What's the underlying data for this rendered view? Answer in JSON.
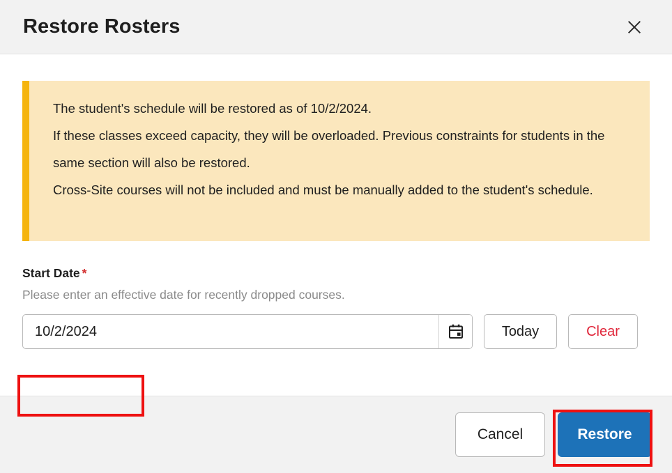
{
  "dialog": {
    "title": "Restore Rosters",
    "close_icon": "close-icon"
  },
  "alert": {
    "accent_color": "#f5b40d",
    "background_color": "#fbe7bd",
    "lines": [
      "The student's schedule will be restored as of 10/2/2024.",
      "If these classes exceed capacity, they will be overloaded. Previous constraints for students in the same section will also be restored.",
      "Cross-Site courses will not be included and must be manually added to the student's schedule."
    ]
  },
  "form": {
    "start_date": {
      "label": "Start Date",
      "required_marker": "*",
      "hint": "Please enter an effective date for recently dropped courses.",
      "value": "10/2/2024",
      "placeholder": "",
      "calendar_icon": "calendar-icon",
      "today_label": "Today",
      "clear_label": "Clear",
      "clear_color": "#e0263a"
    }
  },
  "footer": {
    "cancel_label": "Cancel",
    "restore_label": "Restore",
    "restore_color": "#1d72b8"
  },
  "annotations": {
    "color": "#ee1111",
    "highlighted": [
      "start-date-input",
      "restore-button"
    ]
  }
}
